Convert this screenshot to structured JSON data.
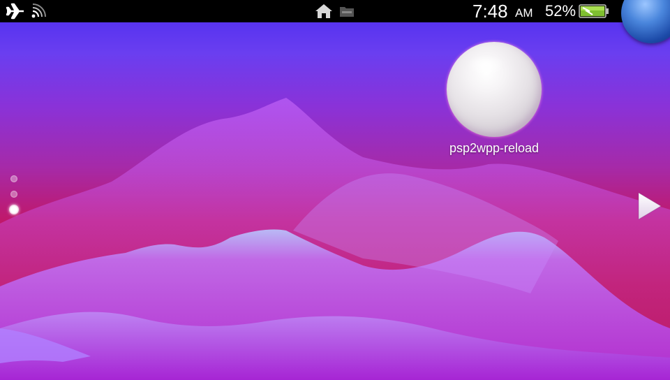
{
  "status_bar": {
    "airplane_icon": "airplane-icon",
    "signal_icon": "wifi-signal-icon",
    "home_icon": "home-icon",
    "folder_icon": "folder-icon",
    "time": "7:48",
    "ampm": "AM",
    "battery_percent": "52%",
    "battery_icon": "battery-charging-icon"
  },
  "home_screen": {
    "apps": [
      {
        "label": "psp2wpp-reload"
      }
    ],
    "page_indicator": {
      "pages": 3,
      "current_page": 3
    }
  },
  "colors": {
    "status_bar_bg": "#000000",
    "bg_top": "#4a2cf0",
    "bg_bottom": "#c0104a",
    "corner_orb": "#2a62c8"
  }
}
